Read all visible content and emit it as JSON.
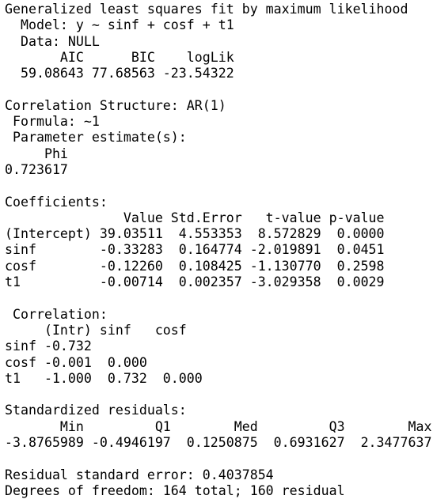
{
  "lines": [
    "Generalized least squares fit by maximum likelihood",
    "  Model: y ~ sinf + cosf + t1",
    "  Data: NULL",
    "       AIC      BIC    logLik",
    "  59.08643 77.68563 -23.54322",
    "",
    "Correlation Structure: AR(1)",
    " Formula: ~1",
    " Parameter estimate(s):",
    "     Phi",
    "0.723617",
    "",
    "Coefficients:",
    "               Value Std.Error   t-value p-value",
    "(Intercept) 39.03511  4.553353  8.572829  0.0000",
    "sinf        -0.33283  0.164774 -2.019891  0.0451",
    "cosf        -0.12260  0.108425 -1.130770  0.2598",
    "t1          -0.00714  0.002357 -3.029358  0.0029",
    "",
    " Correlation:",
    "     (Intr) sinf   cosf",
    "sinf -0.732",
    "cosf -0.001  0.000",
    "t1   -1.000  0.732  0.000",
    "",
    "Standardized residuals:",
    "       Min         Q1        Med         Q3        Max",
    "-3.8765989 -0.4946197  0.1250875  0.6931627  2.3477637",
    "",
    "Residual standard error: 0.4037854",
    "Degrees of freedom: 164 total; 160 residual"
  ]
}
